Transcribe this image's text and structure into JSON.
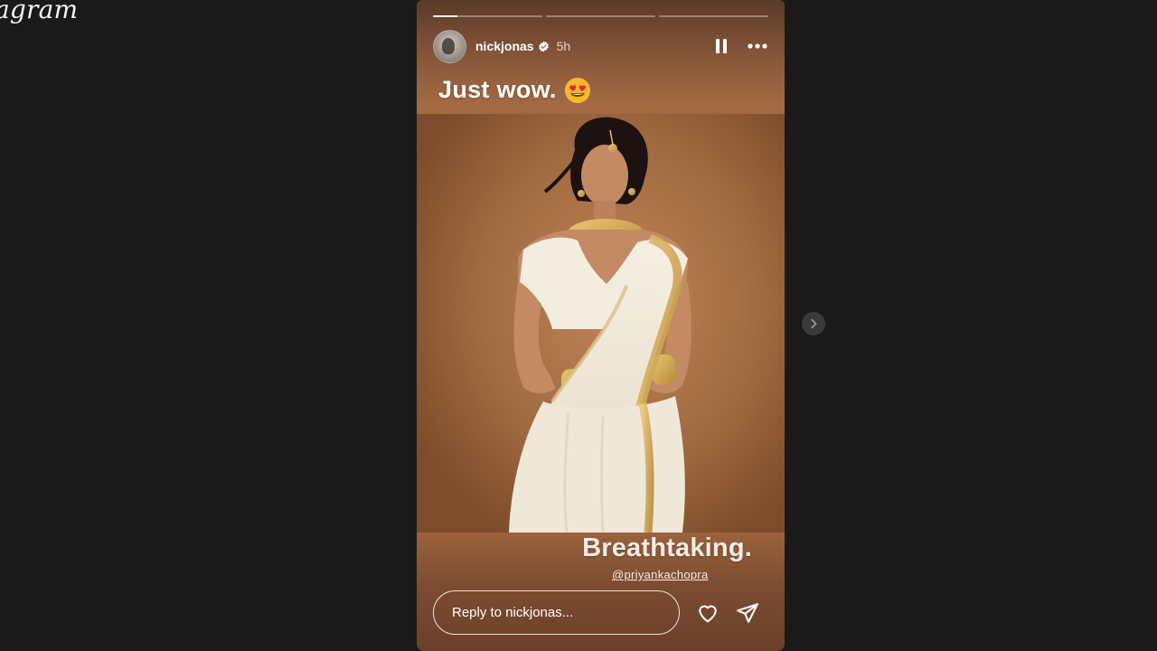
{
  "app": {
    "logo_text": "agram"
  },
  "story": {
    "progress": [
      0.22,
      0,
      0
    ],
    "author": {
      "username": "nickjonas",
      "verified": true,
      "time_ago": "5h"
    },
    "caption_top": "Just wow.",
    "caption_top_emoji": "heart-eyes-emoji",
    "caption_bottom": "Breathtaking.",
    "mention": "@priyankachopra",
    "reply": {
      "placeholder": "Reply to nickjonas..."
    }
  },
  "icons": {
    "pause": "pause-icon",
    "more": "more-icon",
    "like": "heart-icon",
    "share": "send-icon",
    "next": "chevron-right-icon"
  },
  "colors": {
    "page_background": "#1a1a1a",
    "story_background": "#9a623d",
    "emoji_face": "#f7b92c",
    "emoji_heart": "#e2253c"
  }
}
